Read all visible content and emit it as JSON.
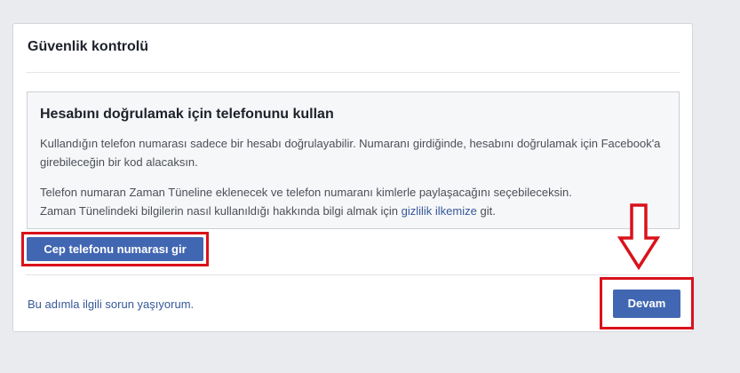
{
  "card": {
    "title": "Güvenlik kontrolü"
  },
  "info": {
    "heading": "Hesabını doğrulamak için telefonunu kullan",
    "para1": "Kullandığın telefon numarası sadece bir hesabı doğrulayabilir. Numaranı girdiğinde, hesabını doğrulamak için Facebook'a girebileceğin bir kod alacaksın.",
    "para2_line1": "Telefon numaran Zaman Tüneline eklenecek ve telefon numaranı kimlerle paylaşacağını seçebileceksin.",
    "para2_line2_pre": "Zaman Tünelindeki bilgilerin nasıl kullanıldığı hakkında bilgi almak için",
    "privacy_link": "gizlilik ilkemize",
    "para2_line2_post": "git."
  },
  "buttons": {
    "phone_label": "Cep telefonu numarası gir",
    "continue_label": "Devam"
  },
  "footer": {
    "problem_link": "Bu adımla ilgili sorun yaşıyorum."
  },
  "colors": {
    "primary": "#4267b2",
    "link": "#365899",
    "highlight": "#d9121b",
    "background": "#e9ebee"
  },
  "icons": {
    "pointer_arrow": "arrow-down-icon"
  }
}
